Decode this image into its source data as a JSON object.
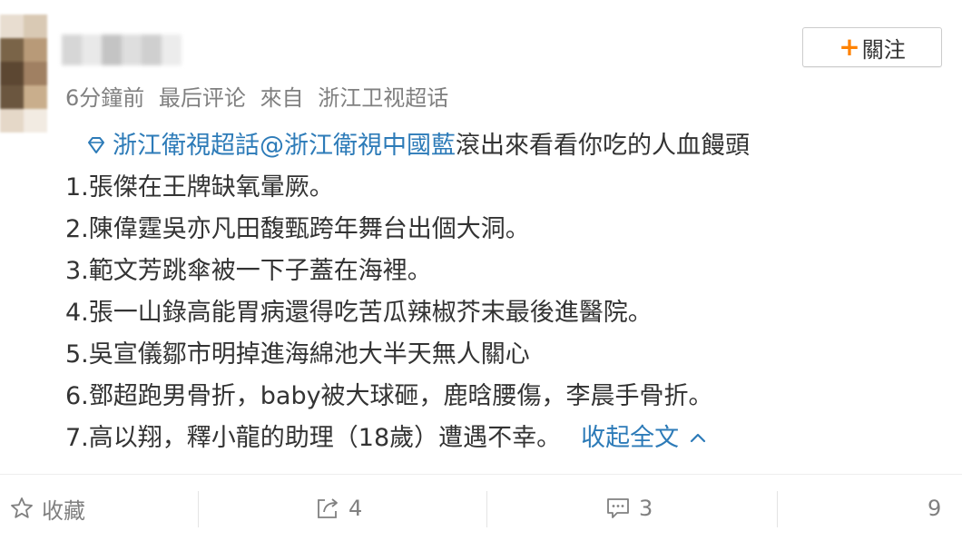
{
  "header": {
    "follow_label": "關注",
    "meta": {
      "time": "6分鐘前",
      "comment_note": "最后评论",
      "from_label": "來自",
      "source": "浙江卫视超话"
    }
  },
  "post": {
    "topic_link": "浙江衛視超話",
    "mention": "@浙江衛視中國藍",
    "intro": "滾出來看看你吃的人血饅頭",
    "items": [
      "1.張傑在王牌缺氧暈厥。",
      "2.陳偉霆吳亦凡田馥甄跨年舞台出個大洞。",
      "3.範文芳跳傘被一下子蓋在海裡。",
      "4.張一山錄高能胃病還得吃苦瓜辣椒芥末最後進醫院。",
      "5.吳宣儀鄒市明掉進海綿池大半天無人關心",
      "6.鄧超跑男骨折，baby被大球砸，鹿晗腰傷，李晨手骨折。",
      "7.高以翔，釋小龍的助理（18歲）遭遇不幸。"
    ],
    "collapse_label": "收起全文"
  },
  "actions": {
    "favorite_label": "收藏",
    "repost_count": "4",
    "comment_count": "3",
    "like_count": "9"
  },
  "colors": {
    "link": "#2d7bb8",
    "accent_plus": "#ff8200",
    "meta_gray": "#808080"
  },
  "icons": [
    "diamond-topic-icon",
    "chevron-up-icon",
    "star-icon",
    "repost-icon",
    "comment-icon",
    "plus-icon"
  ]
}
